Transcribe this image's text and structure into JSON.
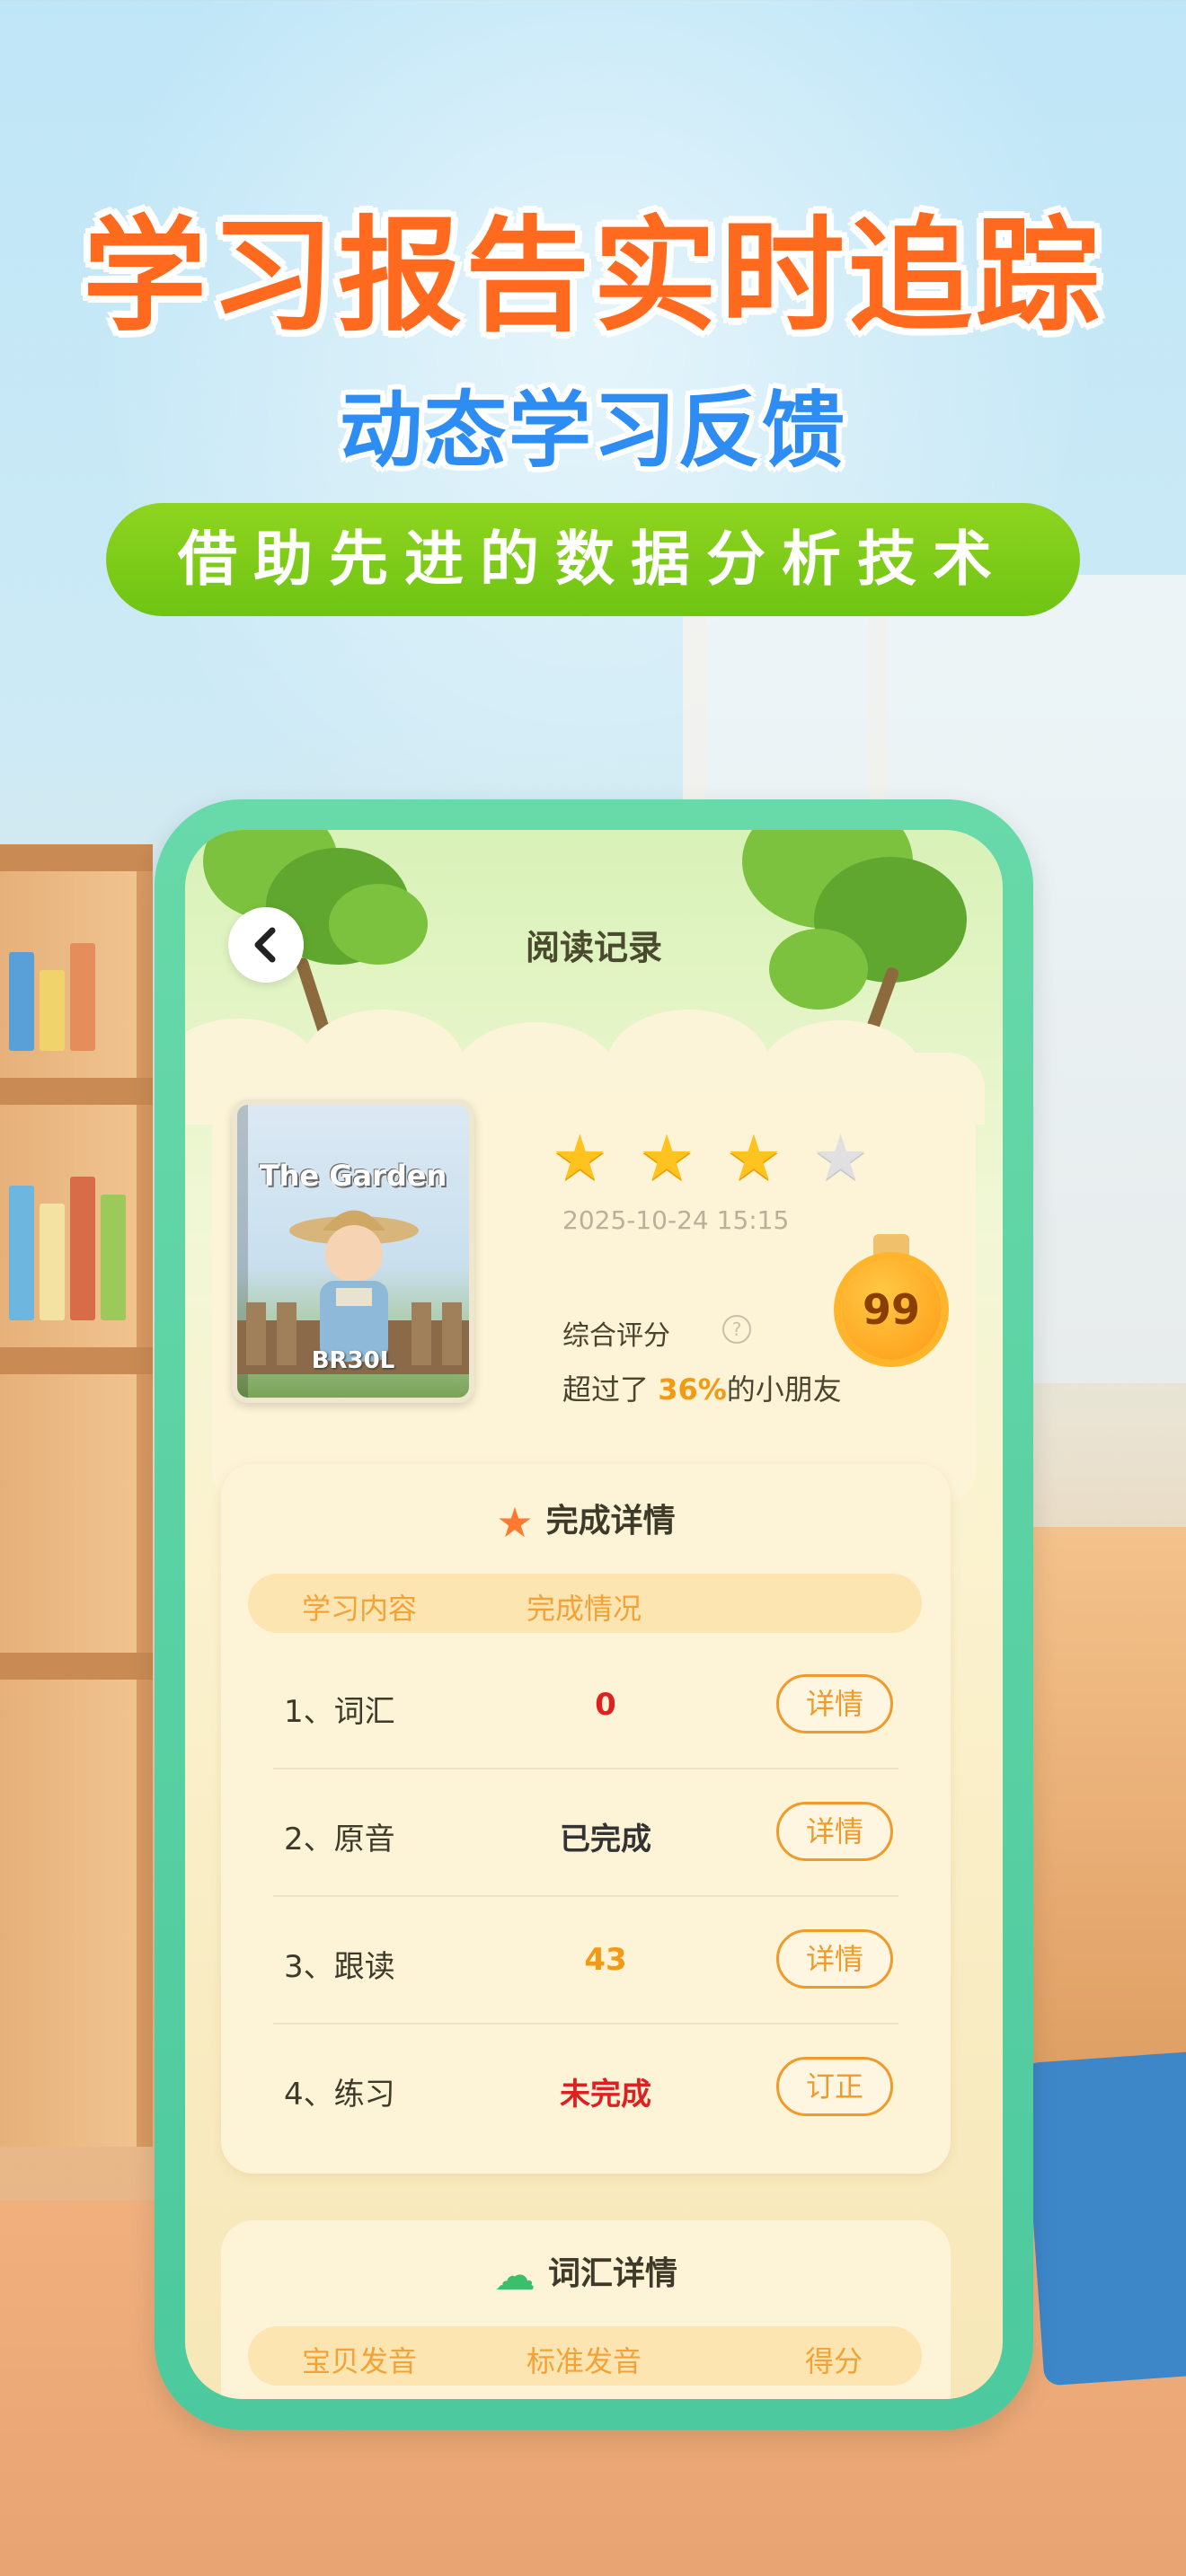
{
  "headline": "学习报告实时追踪",
  "subheadline": "动态学习反馈",
  "tagline": "借助先进的数据分析技术",
  "nav": {
    "title": "阅读记录",
    "back_icon": "chevron-left-icon"
  },
  "book": {
    "cover_title": "The Garden",
    "cover_code": "BR30L",
    "stars_filled": 3,
    "stars_total": 4,
    "date": "2025-10-24 15:15",
    "score_label": "综合评分",
    "help_icon": "question-circle-icon",
    "exceed_prefix": "超过了",
    "exceed_percent": "36%",
    "exceed_suffix": "的小朋友",
    "score": "99"
  },
  "completion": {
    "title": "完成详情",
    "title_icon": "star-check-icon",
    "col_content": "学习内容",
    "col_status": "完成情况",
    "rows": [
      {
        "label": "1、词汇",
        "status": "0",
        "status_color": "#e02020",
        "action": "详情"
      },
      {
        "label": "2、原音",
        "status": "已完成",
        "status_color": "#333333",
        "action": "详情"
      },
      {
        "label": "3、跟读",
        "status": "43",
        "status_color": "#f29a16",
        "action": "详情"
      },
      {
        "label": "4、练习",
        "status": "未完成",
        "status_color": "#e02020",
        "action": "订正"
      }
    ]
  },
  "vocab": {
    "title": "词汇详情",
    "title_icon": "cloud-book-icon",
    "col_baby": "宝贝发音",
    "col_standard": "标准发音",
    "col_score": "得分"
  },
  "colors": {
    "headline": "#ff6a1f",
    "subheadline": "#2d8df3",
    "pill": "#7ccb17",
    "phone_frame": "#5bd1a4",
    "accent_orange": "#f09a2c"
  }
}
